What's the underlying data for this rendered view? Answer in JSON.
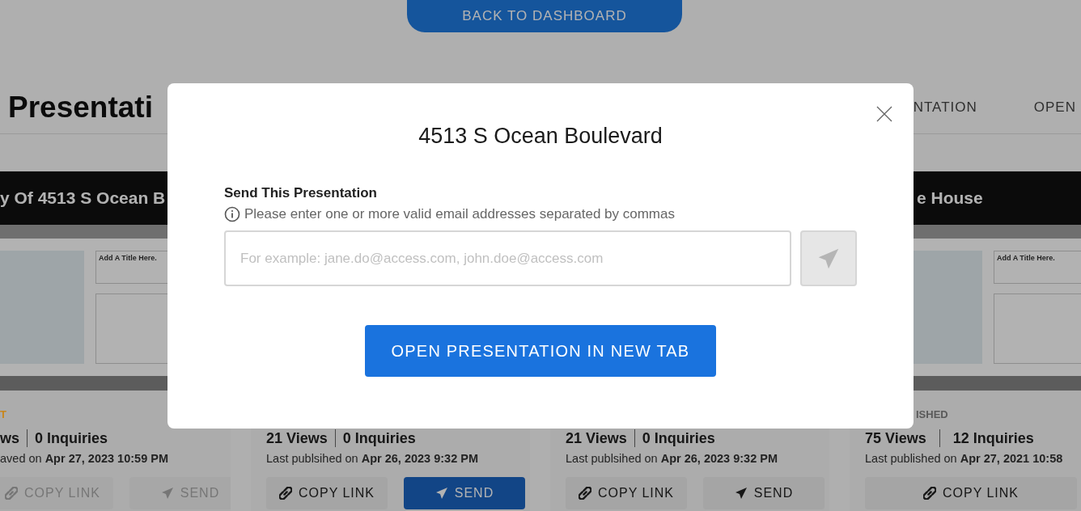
{
  "back_button": {
    "label": "BACK TO DASHBOARD"
  },
  "header": {
    "title": "Presentati",
    "tabs": [
      {
        "label": "NTATION"
      },
      {
        "label": "OPEN"
      }
    ]
  },
  "cards": [
    {
      "title": "y Of 4513 S Ocean B",
      "thumbnail": {
        "title_text": "Add A Title Here."
      },
      "status": {
        "text": "T",
        "color": "#c8861c"
      },
      "views": "ws",
      "inquiries": "0 Inquiries",
      "date": "aved on **Apr 27, 2023 10:59 PM**",
      "buttons": [
        {
          "kind": "copy",
          "label": "COPY LINK",
          "disabled": true,
          "primary": false
        },
        {
          "kind": "send",
          "label": "SEND",
          "disabled": true,
          "primary": false
        }
      ]
    },
    {
      "views": "21 Views",
      "inquiries": "0 Inquiries",
      "date": "Last publsihed on **Apr 26, 2023 9:32 PM**",
      "buttons": [
        {
          "kind": "copy",
          "label": "COPY LINK",
          "disabled": false,
          "primary": false
        },
        {
          "kind": "send",
          "label": "SEND",
          "disabled": false,
          "primary": true
        }
      ]
    },
    {
      "views": "21 Views",
      "inquiries": "0 Inquiries",
      "date": "Last publsihed on **Apr 26, 2023 9:32 PM**",
      "buttons": [
        {
          "kind": "copy",
          "label": "COPY LINK",
          "disabled": false,
          "primary": false
        },
        {
          "kind": "send",
          "label": "SEND",
          "disabled": false,
          "primary": false
        }
      ]
    },
    {
      "title": "e House",
      "thumbnail": {
        "title_text": "Add A Title Here."
      },
      "status": {
        "text": "ISHED",
        "color": "#5a5a5a"
      },
      "views": "75 Views",
      "inquiries": "12 Inquiries",
      "date": "Last published on **Apr 27, 2021 10:58**",
      "buttons": [
        {
          "kind": "copy",
          "label": "COPY LINK",
          "disabled": false,
          "primary": false
        }
      ]
    }
  ],
  "modal": {
    "title": "4513 S Ocean Boulevard",
    "label": "Send This Presentation",
    "hint": "Please enter one or more valid email addresses separated by commas",
    "email_field": {
      "placeholder": "For example: jane.do@access.com, john.doe@access.com"
    },
    "send_disabled": true,
    "open_button": "OPEN PRESENTATION IN NEW TAB"
  }
}
